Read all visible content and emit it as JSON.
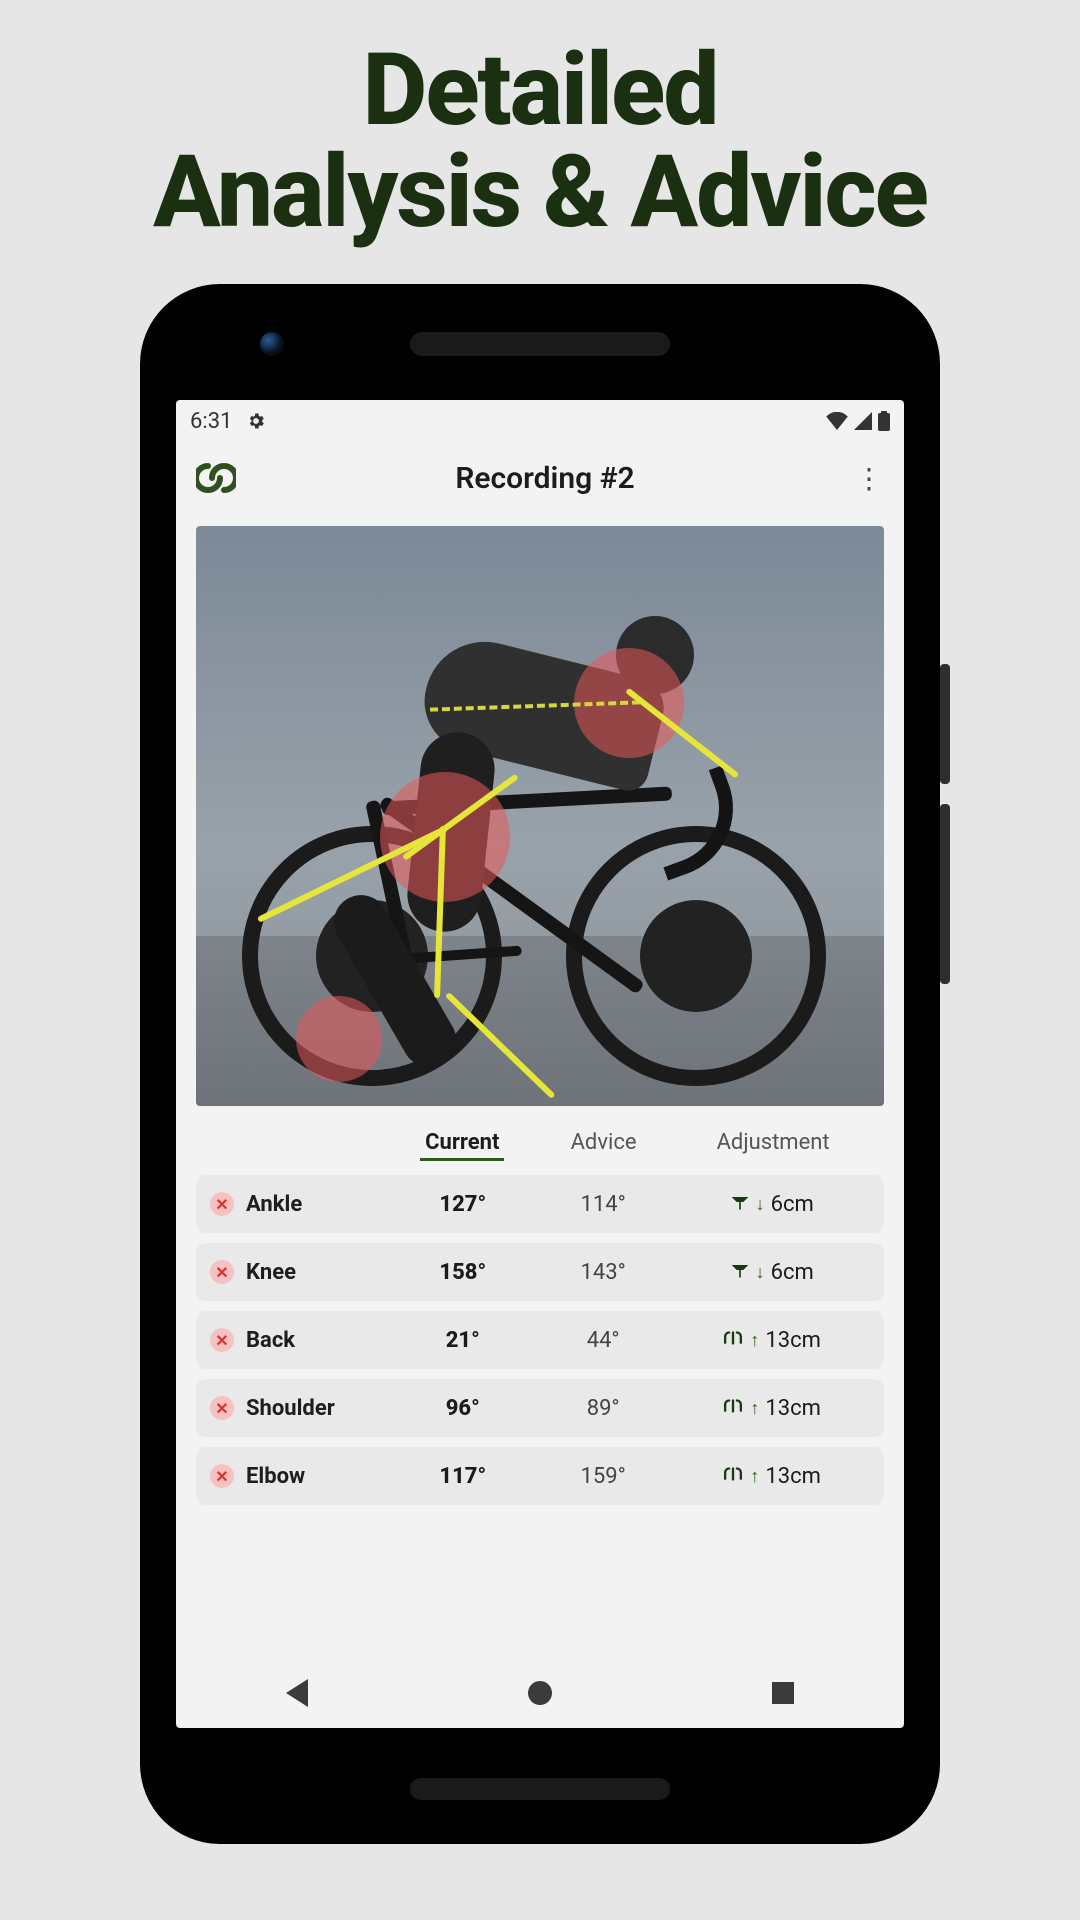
{
  "promo": {
    "line1": "Detailed",
    "line2": "Analysis & Advice"
  },
  "status": {
    "time": "6:31"
  },
  "header": {
    "title": "Recording #2"
  },
  "columns": {
    "current": "Current",
    "advice": "Advice",
    "adjustment": "Adjustment"
  },
  "rows": [
    {
      "name": "Ankle",
      "current": "127°",
      "advice": "114°",
      "adj_icon": "saddle",
      "adj_dir": "↓",
      "adj_val": "6cm"
    },
    {
      "name": "Knee",
      "current": "158°",
      "advice": "143°",
      "adj_icon": "saddle",
      "adj_dir": "↓",
      "adj_val": "6cm"
    },
    {
      "name": "Back",
      "current": "21°",
      "advice": "44°",
      "adj_icon": "handlebar",
      "adj_dir": "↑",
      "adj_val": "13cm"
    },
    {
      "name": "Shoulder",
      "current": "96°",
      "advice": "89°",
      "adj_icon": "handlebar",
      "adj_dir": "↑",
      "adj_val": "13cm"
    },
    {
      "name": "Elbow",
      "current": "117°",
      "advice": "159°",
      "adj_icon": "handlebar",
      "adj_dir": "↑",
      "adj_val": "13cm"
    }
  ]
}
